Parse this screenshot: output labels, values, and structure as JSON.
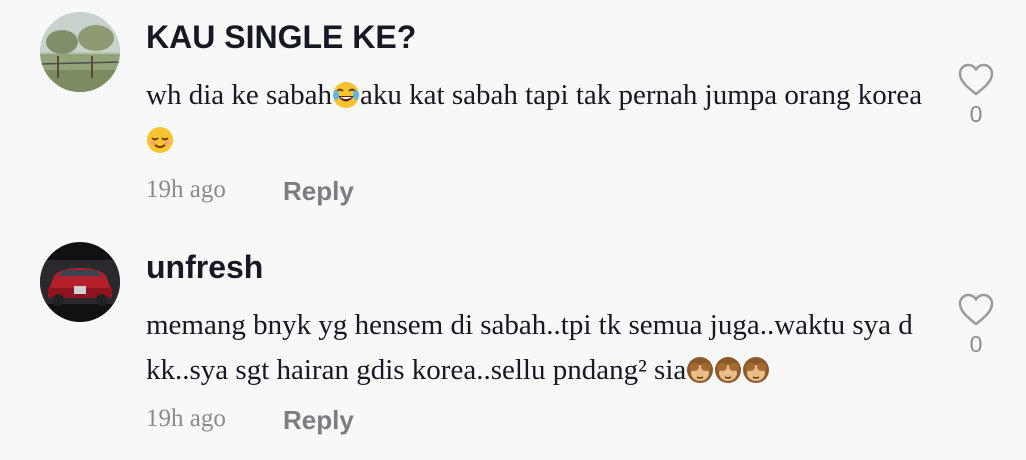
{
  "comments": [
    {
      "username": "KAU SINGLE KE?",
      "text_parts": [
        "wh dia ke sabah",
        "aku kat sabah tapi tak pernah jumpa orang korea"
      ],
      "emojis": [
        "face-with-tears-of-joy",
        "relieved-face"
      ],
      "time": "19h ago",
      "reply_label": "Reply",
      "like_count": "0",
      "avatar": "landscape-photo-avatar"
    },
    {
      "username": "unfresh",
      "text_parts": [
        "memang bnyk yg hensem di sabah..tpi tk semua juga..waktu sya d kk..sya sgt hairan gdis korea..sellu pndang² sia"
      ],
      "emojis": [
        "see-no-evil-monkey",
        "see-no-evil-monkey",
        "see-no-evil-monkey"
      ],
      "time": "19h ago",
      "reply_label": "Reply",
      "like_count": "0",
      "avatar": "red-car-avatar"
    }
  ],
  "colors": {
    "background": "#f8f8f8",
    "username": "#161823",
    "secondary": "#8a8b91",
    "reply": "#7c7d83",
    "icon": "#9a9ba1"
  }
}
